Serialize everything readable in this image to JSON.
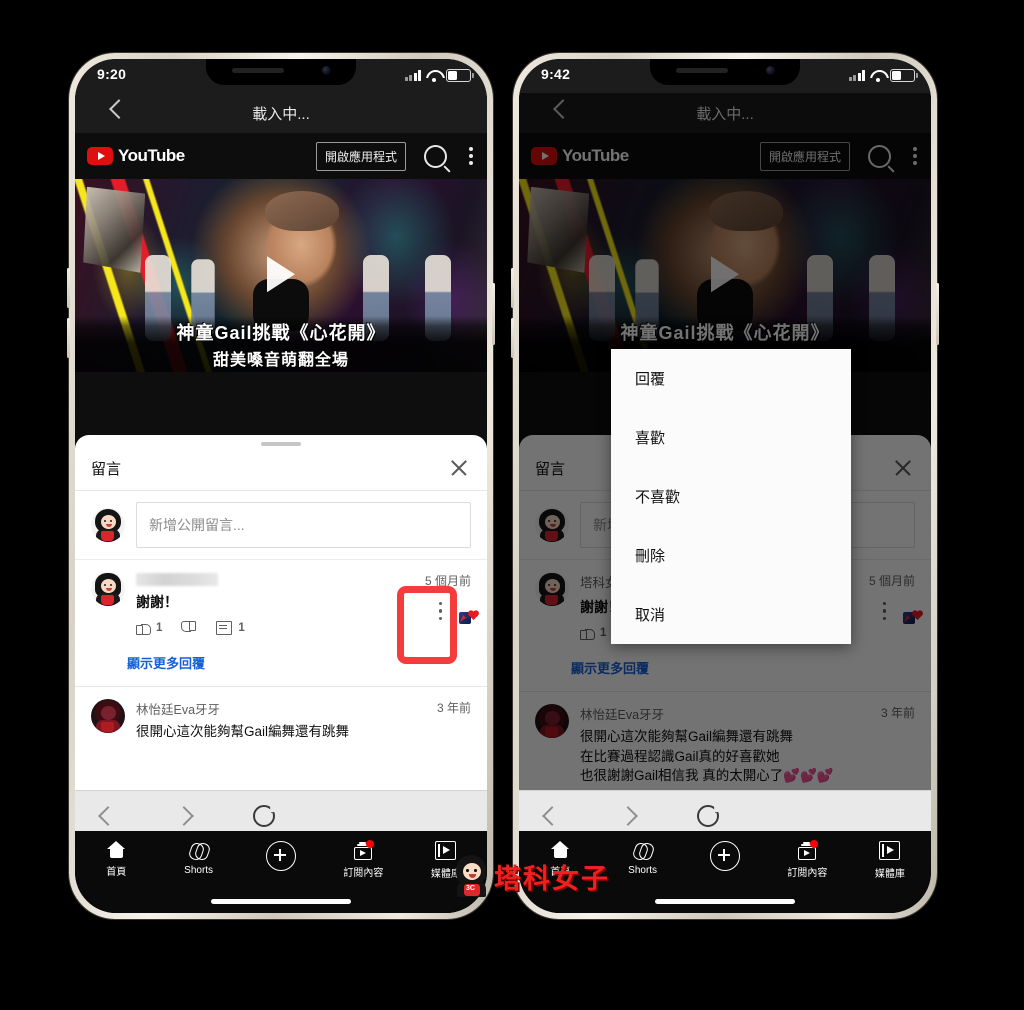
{
  "watermark": {
    "text": "塔科女子",
    "badge": "3C"
  },
  "phones": [
    {
      "id": "left",
      "status": {
        "time": "9:20",
        "signal_icon": "cellular-bars-icon",
        "wifi_icon": "wifi-icon",
        "battery_icon": "battery-icon"
      },
      "safari": {
        "title": "載入中...",
        "back_icon": "chevron-left-icon"
      },
      "yt_header": {
        "logo_text": "YouTube",
        "open_app_label": "開啟應用程式",
        "search_icon": "search-icon",
        "kebab_icon": "kebab-menu-icon"
      },
      "video": {
        "title_line1": "神童Gail挑戰《心花開》",
        "title_line2": "甜美嗓音萌翻全場",
        "play_icon": "play-button-icon"
      },
      "sheet": {
        "header_title": "留言",
        "close_icon": "close-icon",
        "composer_placeholder": "新增公開留言...",
        "comments": [
          {
            "author_blurred": true,
            "author": "",
            "time": "5 個月前",
            "text": "謝謝！",
            "likes": "1",
            "dislikes": "",
            "replies": "1",
            "more_icon": "kebab-menu-icon",
            "heart_badge": "creator-heart-icon"
          },
          {
            "author_blurred": false,
            "author": "林怡廷Eva牙牙",
            "time": "3 年前",
            "text": "很開心這次能夠幫Gail編舞還有跳舞"
          }
        ],
        "show_more_replies": "顯示更多回覆"
      },
      "safari_bottom": {
        "back_icon": "chevron-left-icon",
        "forward_icon": "chevron-right-icon",
        "reload_icon": "reload-icon"
      },
      "yt_nav": [
        {
          "label": "首頁",
          "icon": "home-icon",
          "badge": false
        },
        {
          "label": "Shorts",
          "icon": "shorts-icon",
          "badge": false
        },
        {
          "label": "",
          "icon": "plus-circle-icon",
          "badge": false
        },
        {
          "label": "訂閱內容",
          "icon": "subscriptions-icon",
          "badge": true
        },
        {
          "label": "媒體庫",
          "icon": "library-icon",
          "badge": false
        }
      ]
    },
    {
      "id": "right",
      "status": {
        "time": "9:42",
        "signal_icon": "cellular-bars-icon",
        "wifi_icon": "wifi-icon",
        "battery_icon": "battery-icon"
      },
      "safari": {
        "title": "載入中...",
        "back_icon": "chevron-left-icon"
      },
      "yt_header": {
        "logo_text": "YouTube",
        "open_app_label": "開啟應用程式",
        "search_icon": "search-icon",
        "kebab_icon": "kebab-menu-icon"
      },
      "video": {
        "title_line1": "神童Gail挑戰《心花開》",
        "title_line2": "甜美嗓音萌翻全場",
        "play_icon": "play-button-icon"
      },
      "sheet": {
        "header_title": "留言",
        "close_icon": "close-icon",
        "composer_placeholder": "新增公開留言...",
        "comments": [
          {
            "author_blurred": false,
            "author": "塔科女子",
            "time": "5 個月前",
            "text": "謝謝！",
            "likes": "1",
            "dislikes": "",
            "replies": "1",
            "more_icon": "kebab-menu-icon",
            "heart_badge": "creator-heart-icon"
          },
          {
            "author_blurred": false,
            "author": "林怡廷Eva牙牙",
            "time": "3 年前",
            "text": "很開心這次能夠幫Gail編舞還有跳舞\n在比賽過程認識Gail真的好喜歡她\n也很謝謝Gail相信我 真的太開心了💕💕💕"
          }
        ],
        "show_more_replies": "顯示更多回覆"
      },
      "action_sheet": {
        "items": [
          {
            "label": "回覆"
          },
          {
            "label": "喜歡"
          },
          {
            "label": "不喜歡"
          },
          {
            "label": "刪除"
          },
          {
            "label": "取消"
          }
        ]
      },
      "safari_bottom": {
        "back_icon": "chevron-left-icon",
        "forward_icon": "chevron-right-icon",
        "reload_icon": "reload-icon"
      },
      "yt_nav": [
        {
          "label": "首頁",
          "icon": "home-icon",
          "badge": false
        },
        {
          "label": "Shorts",
          "icon": "shorts-icon",
          "badge": false
        },
        {
          "label": "",
          "icon": "plus-circle-icon",
          "badge": false
        },
        {
          "label": "訂閱內容",
          "icon": "subscriptions-icon",
          "badge": true
        },
        {
          "label": "媒體庫",
          "icon": "library-icon",
          "badge": false
        }
      ]
    }
  ],
  "colors": {
    "background": "#000000",
    "accent_red": "#ff0000",
    "highlight_box": "#f43c3c",
    "link_blue": "#1560d8",
    "sheet_bg": "#ffffff",
    "yt_dark": "#0d0d0d"
  }
}
